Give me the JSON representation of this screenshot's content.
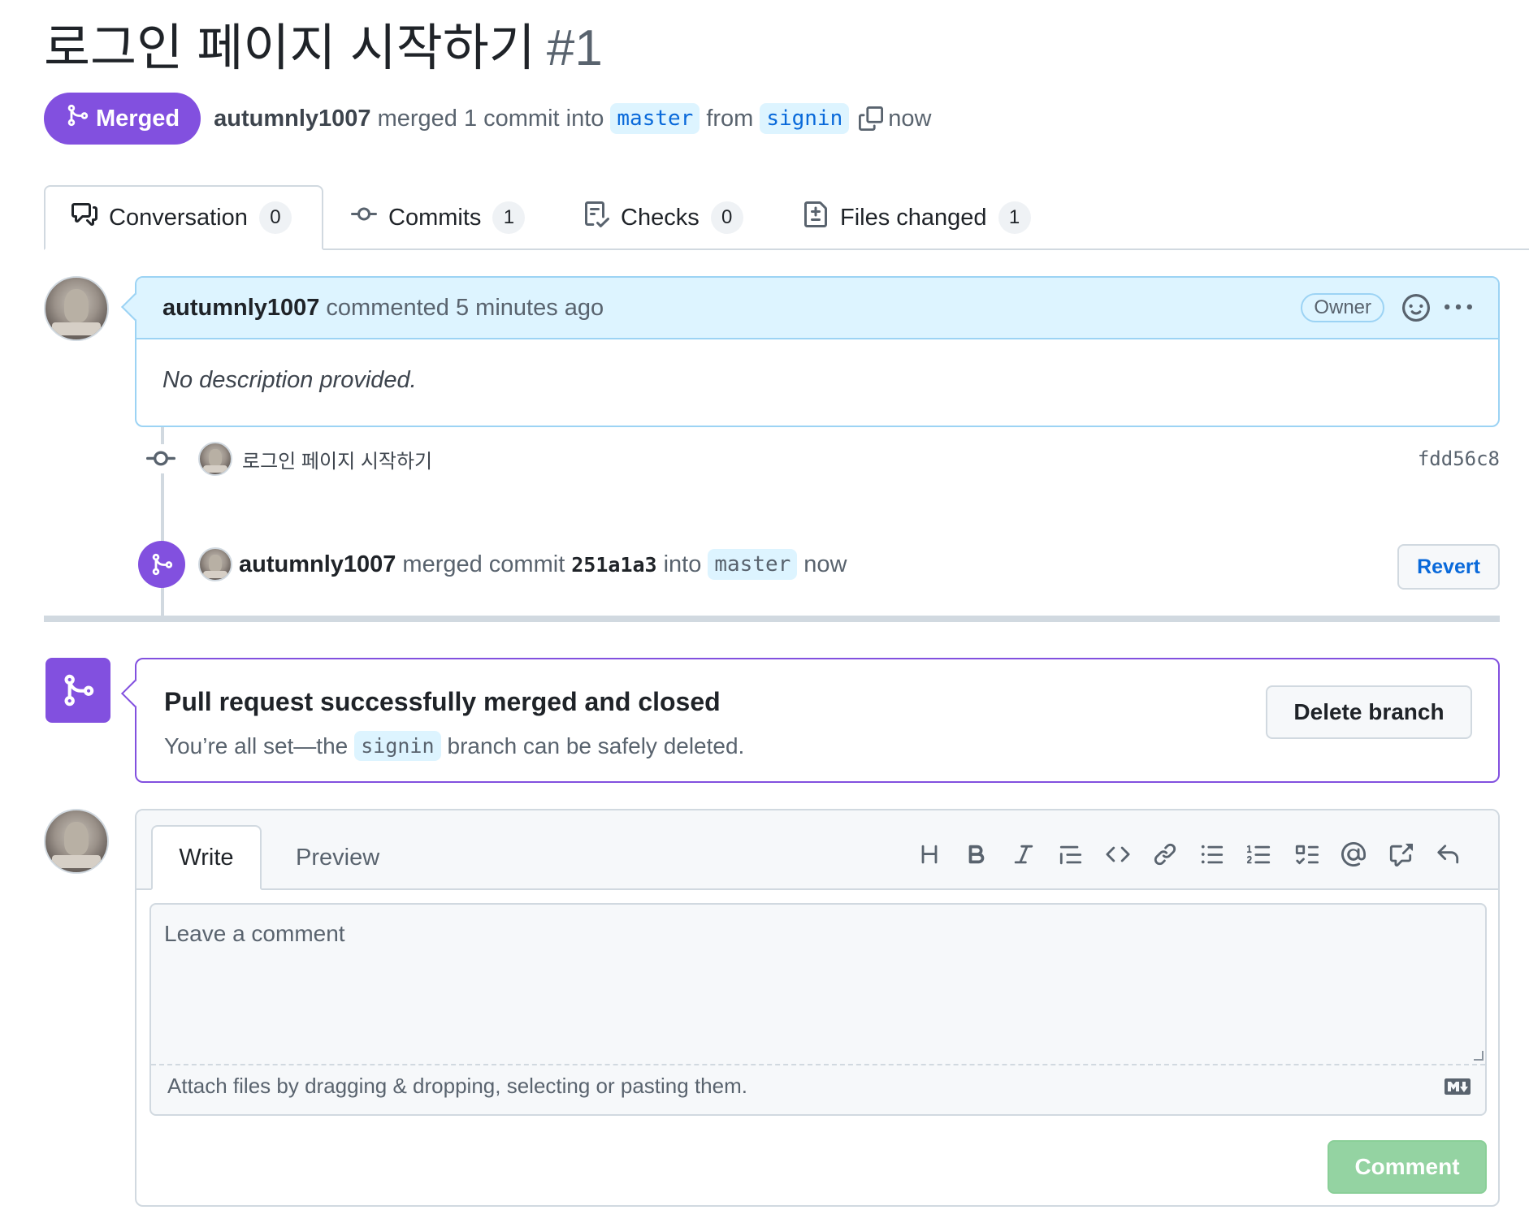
{
  "pr": {
    "title": "로그인 페이지 시작하기",
    "number": "#1",
    "state_label": "Merged",
    "author": "autumnly1007",
    "merge_text": "merged 1 commit into",
    "base_branch": "master",
    "from_text": "from",
    "head_branch": "signin",
    "time": "now"
  },
  "tabs": [
    {
      "label": "Conversation",
      "count": "0",
      "icon": "comment-discussion-icon"
    },
    {
      "label": "Commits",
      "count": "1",
      "icon": "git-commit-icon"
    },
    {
      "label": "Checks",
      "count": "0",
      "icon": "checklist-icon"
    },
    {
      "label": "Files changed",
      "count": "1",
      "icon": "file-diff-icon"
    }
  ],
  "comment": {
    "author": "autumnly1007",
    "meta": "commented 5 minutes ago",
    "badge": "Owner",
    "body": "No description provided."
  },
  "commit": {
    "message": "로그인  페이지  시작하기",
    "sha": "fdd56c8"
  },
  "merge_event": {
    "author": "autumnly1007",
    "text1": "merged commit",
    "sha": "251a1a3",
    "text2": "into",
    "branch": "master",
    "time": "now",
    "revert_label": "Revert"
  },
  "merged_box": {
    "title": "Pull request successfully merged and closed",
    "sub_before": "You’re all set—the",
    "branch": "signin",
    "sub_after": "branch can be safely deleted.",
    "delete_label": "Delete branch"
  },
  "composer": {
    "write_tab": "Write",
    "preview_tab": "Preview",
    "placeholder": "Leave a comment",
    "attach_text": "Attach files by dragging & dropping, selecting or pasting them.",
    "submit_label": "Comment",
    "toolbar": [
      "heading-icon",
      "bold-icon",
      "italic-icon",
      "quote-icon",
      "code-icon",
      "link-icon",
      "unordered-list-icon",
      "ordered-list-icon",
      "task-list-icon",
      "mention-icon",
      "cross-reference-icon",
      "reply-icon"
    ]
  },
  "colors": {
    "merged_purple": "#8250df",
    "link_blue": "#0969da",
    "comment_header_bg": "#ddf4ff",
    "comment_button_green": "#94d3a2"
  }
}
